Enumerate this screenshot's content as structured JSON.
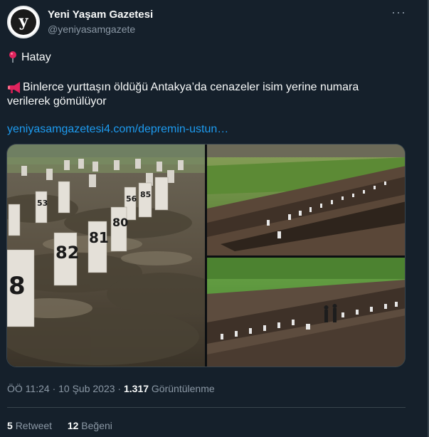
{
  "author": {
    "name": "Yeni Yaşam Gazetesi",
    "handle": "@yeniyasamgazete",
    "avatar_letter": "y"
  },
  "tweet": {
    "location_emoji_icon": "round-pushpin-icon",
    "location": "Hatay",
    "loudspeaker_icon": "loudspeaker-icon",
    "text_line1": "Binlerce yurttaşın öldüğü Antakya’da cenazeler isim yerine numara",
    "text_line2": "verilerek gömülüyor",
    "link": "yeniyasamgazetesi4.com/depremin-ustun…"
  },
  "media": {
    "left_photo_markers": [
      "53",
      "56",
      "85",
      "80",
      "81",
      "82",
      "8"
    ],
    "description_icon": "photo-grid"
  },
  "meta": {
    "time": "ÖÖ 11:24",
    "separator": "·",
    "date": "10 Şub 2023",
    "views_count": "1.317",
    "views_label": "Görüntülenme"
  },
  "stats": {
    "retweets_count": "5",
    "retweets_label": "Retweet",
    "likes_count": "12",
    "likes_label": "Beğeni"
  },
  "colors": {
    "background": "#15202b",
    "text": "#f7f9f9",
    "secondary": "#8b98a5",
    "link": "#1d9bf0",
    "divider": "#38444d"
  }
}
